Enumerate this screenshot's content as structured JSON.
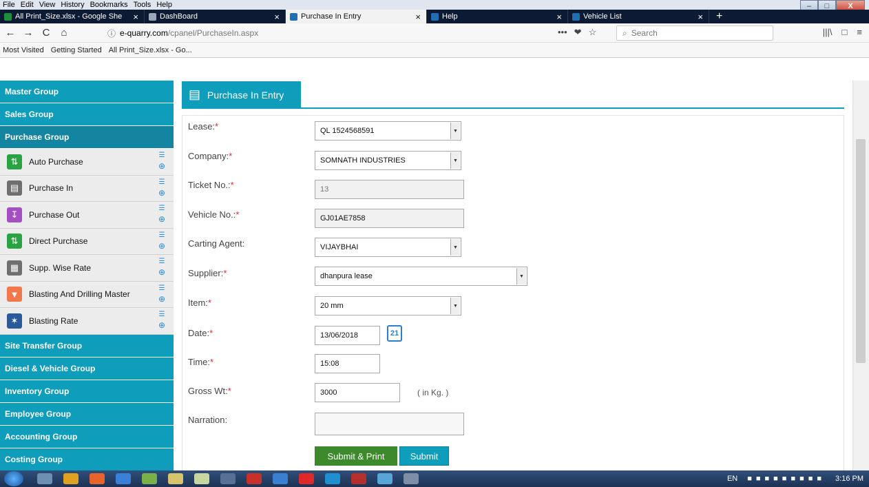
{
  "menubar": {
    "items": [
      "File",
      "Edit",
      "View",
      "History",
      "Bookmarks",
      "Tools",
      "Help"
    ]
  },
  "window_controls": {
    "minimize": "‒",
    "maximize": "□",
    "close": "X"
  },
  "tabs": [
    {
      "label": "All Print_Size.xlsx - Google She",
      "icon": "sheets-icon",
      "color": "#1e8e3e"
    },
    {
      "label": "DashBoard",
      "icon": "dashboard-icon",
      "color": "#9aa7bd"
    },
    {
      "label": "Purchase In Entry",
      "icon": "quarry-icon",
      "color": "#1f6fb3",
      "active": true
    },
    {
      "label": "Help",
      "icon": "quarry-icon",
      "color": "#1f6fb3"
    },
    {
      "label": "Vehicle List",
      "icon": "quarry-icon",
      "color": "#1f6fb3"
    }
  ],
  "tab_close_glyph": "×",
  "newtab_glyph": "+",
  "nav": {
    "back": "←",
    "forward": "→",
    "reload": "C",
    "home": "⌂"
  },
  "url": {
    "info_glyph": "ⓘ",
    "domain": "e-quarry.com",
    "path": "/cpanel/PurchaseIn.aspx",
    "more": "•••",
    "pocket": "❤",
    "star": "☆"
  },
  "search": {
    "placeholder": "Search",
    "glyph": "⌕"
  },
  "toolbar_right": {
    "library": "|||\\",
    "sidebar": "□",
    "menu": "≡"
  },
  "bookmarks": [
    "Most Visited",
    "Getting Started",
    "All Print_Size.xlsx - Go..."
  ],
  "sidebar": {
    "groups_top": [
      "Master Group",
      "Sales Group",
      "Purchase Group"
    ],
    "items": [
      {
        "label": "Auto Purchase",
        "icon": "arrows-icon"
      },
      {
        "label": "Purchase In",
        "icon": "cart-icon"
      },
      {
        "label": "Purchase Out",
        "icon": "cart-out-icon"
      },
      {
        "label": "Direct Purchase",
        "icon": "arrows-icon"
      },
      {
        "label": "Supp. Wise Rate",
        "icon": "rate-icon"
      },
      {
        "label": "Blasting And Drilling Master",
        "icon": "drill-icon"
      },
      {
        "label": "Blasting Rate",
        "icon": "blast-icon"
      }
    ],
    "groups_bottom": [
      "Site Transfer Group",
      "Diesel & Vehicle Group",
      "Inventory Group",
      "Employee Group",
      "Accounting Group",
      "Costing Group"
    ]
  },
  "page": {
    "title": "Purchase In Entry"
  },
  "form": {
    "lease": {
      "label": "Lease:",
      "value": "QL 1524568591"
    },
    "company": {
      "label": "Company:",
      "value": "SOMNATH INDUSTRIES"
    },
    "ticket": {
      "label": "Ticket No.:",
      "value": "13"
    },
    "vehicle": {
      "label": "Vehicle No.:",
      "value": "GJ01AE7858"
    },
    "agent": {
      "label": "Carting Agent:",
      "value": "VIJAYBHAI"
    },
    "supplier": {
      "label": "Supplier:",
      "value": "dhanpura lease"
    },
    "item": {
      "label": "Item:",
      "value": "20 mm"
    },
    "date": {
      "label": "Date:",
      "value": "13/06/2018",
      "calendar_day": "21"
    },
    "time": {
      "label": "Time:",
      "value": "15:08"
    },
    "gross": {
      "label": "Gross Wt:",
      "value": "3000",
      "unit": "( in Kg. )"
    },
    "narration": {
      "label": "Narration:",
      "value": ""
    },
    "required_mark": "*",
    "submit_print": "Submit & Print",
    "submit": "Submit"
  },
  "tray": {
    "lang": "EN",
    "clock": "3:16 PM"
  }
}
